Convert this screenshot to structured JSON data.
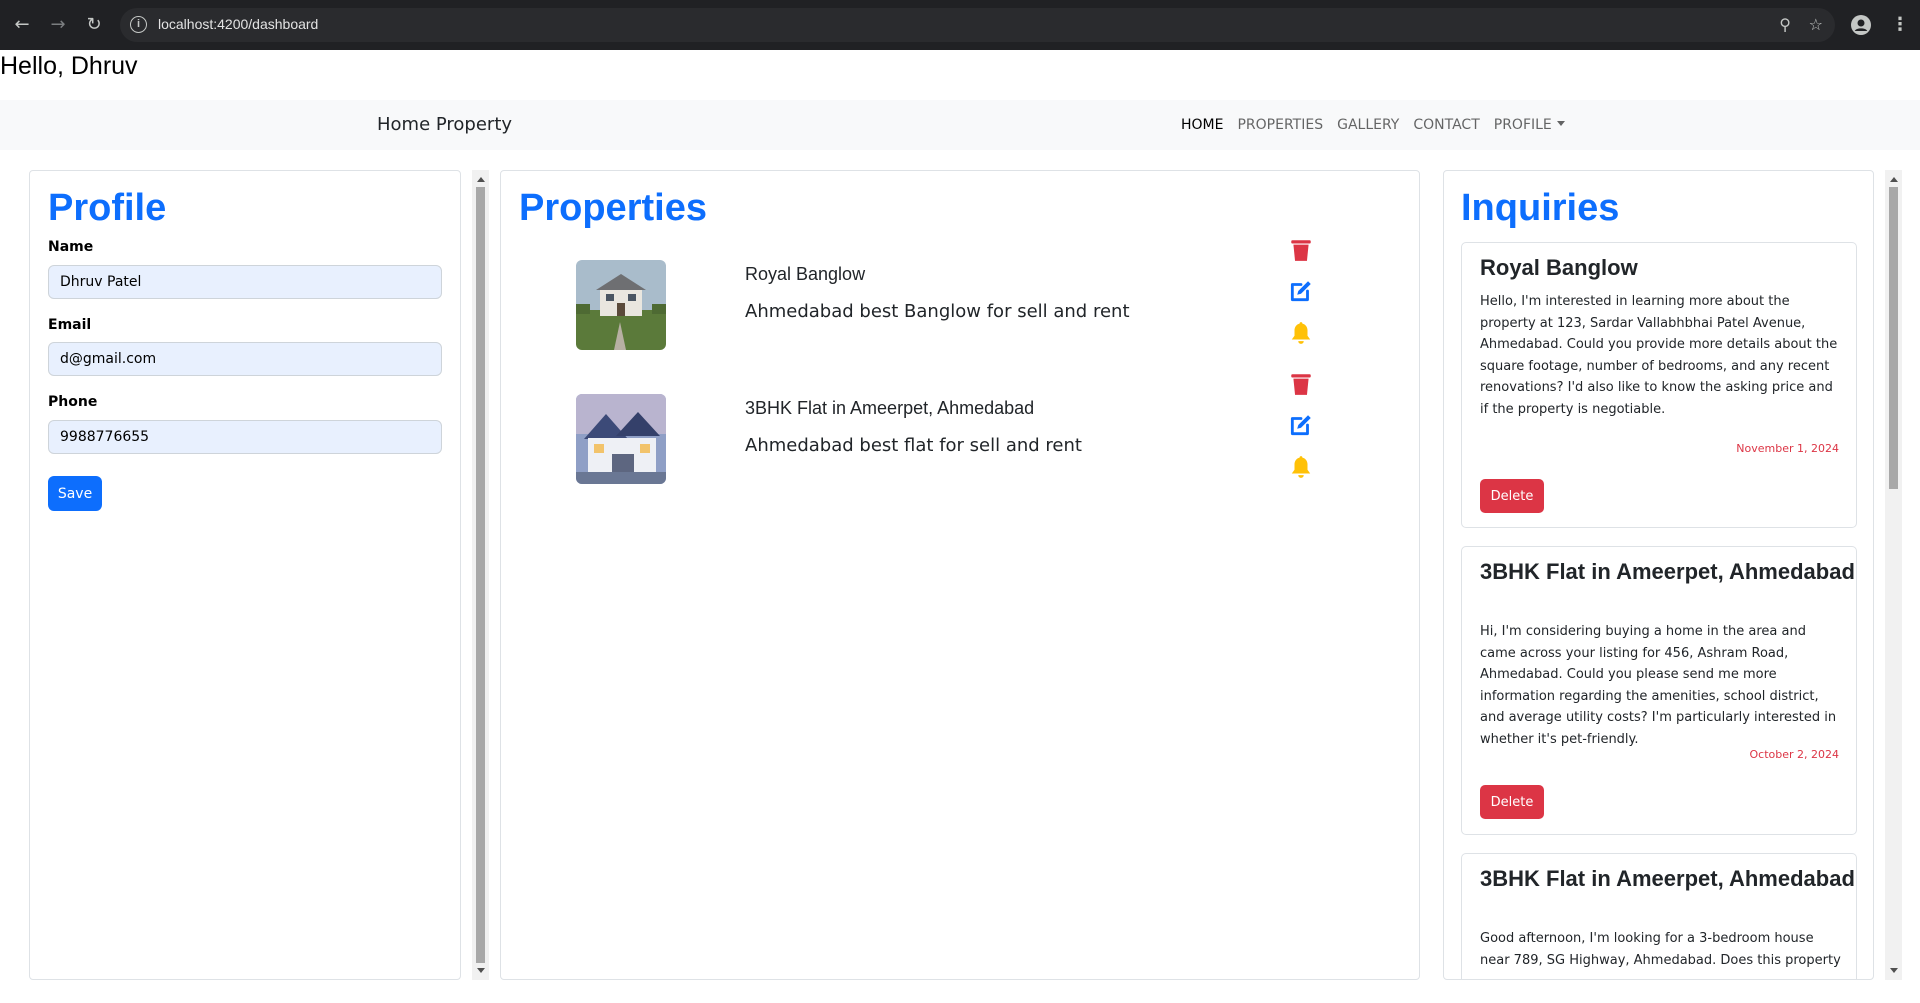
{
  "browser": {
    "url": "localhost:4200/dashboard"
  },
  "greeting": "Hello, Dhruv",
  "navbar": {
    "brand": "Home Property",
    "links": [
      "HOME",
      "PROPERTIES",
      "GALLERY",
      "CONTACT",
      "PROFILE"
    ],
    "active": "HOME"
  },
  "profile": {
    "title": "Profile",
    "name_label": "Name",
    "name_value": "Dhruv Patel",
    "email_label": "Email",
    "email_value": "d@gmail.com",
    "phone_label": "Phone",
    "phone_value": "9988776655",
    "save_label": "Save"
  },
  "properties": {
    "title": "Properties",
    "items": [
      {
        "name": "Royal Banglow",
        "description": "Ahmedabad best Banglow for sell and rent"
      },
      {
        "name": "3BHK Flat in Ameerpet, Ahmedabad",
        "description": "Ahmedabad best flat for sell and rent"
      }
    ]
  },
  "inquiries": {
    "title": "Inquiries",
    "delete_label": "Delete",
    "items": [
      {
        "title": "Royal Banglow",
        "message": "Hello, I'm interested in learning more about the property at 123, Sardar Vallabhbhai Patel Avenue, Ahmedabad. Could you provide more details about the square footage, number of bedrooms, and any recent renovations? I'd also like to know the asking price and if the property is negotiable.",
        "date": "November 1, 2024"
      },
      {
        "title": "3BHK Flat in Ameerpet, Ahmedabad",
        "message": "Hi, I'm considering buying a home in the area and came across your listing for 456, Ashram Road, Ahmedabad. Could you please send me more information regarding the amenities, school district, and average utility costs? I'm particularly interested in whether it's pet-friendly.",
        "date": "October 2, 2024"
      },
      {
        "title": "3BHK Flat in Ameerpet, Ahmedabad",
        "message": "Good afternoon, I'm looking for a 3-bedroom house near 789, SG Highway, Ahmedabad. Does this property"
      }
    ]
  },
  "colors": {
    "primary": "#0d6efd",
    "danger": "#dc3545",
    "warning": "#ffc107"
  }
}
